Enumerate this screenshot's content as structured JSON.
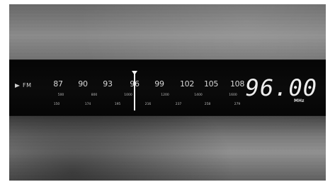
{
  "radio": {
    "band_label": "FM",
    "band_icon": "play-triangle-icon",
    "frequency": "96.00",
    "unit": "MHz",
    "dial_main": [
      "87",
      "90",
      "93",
      "96",
      "99",
      "102",
      "105",
      "108"
    ],
    "dial_sub1": [
      "500",
      "800",
      "1000",
      "1200",
      "1400",
      "1600"
    ],
    "dial_sub2": [
      "150",
      "174",
      "195",
      "216",
      "237",
      "258",
      "279"
    ]
  }
}
